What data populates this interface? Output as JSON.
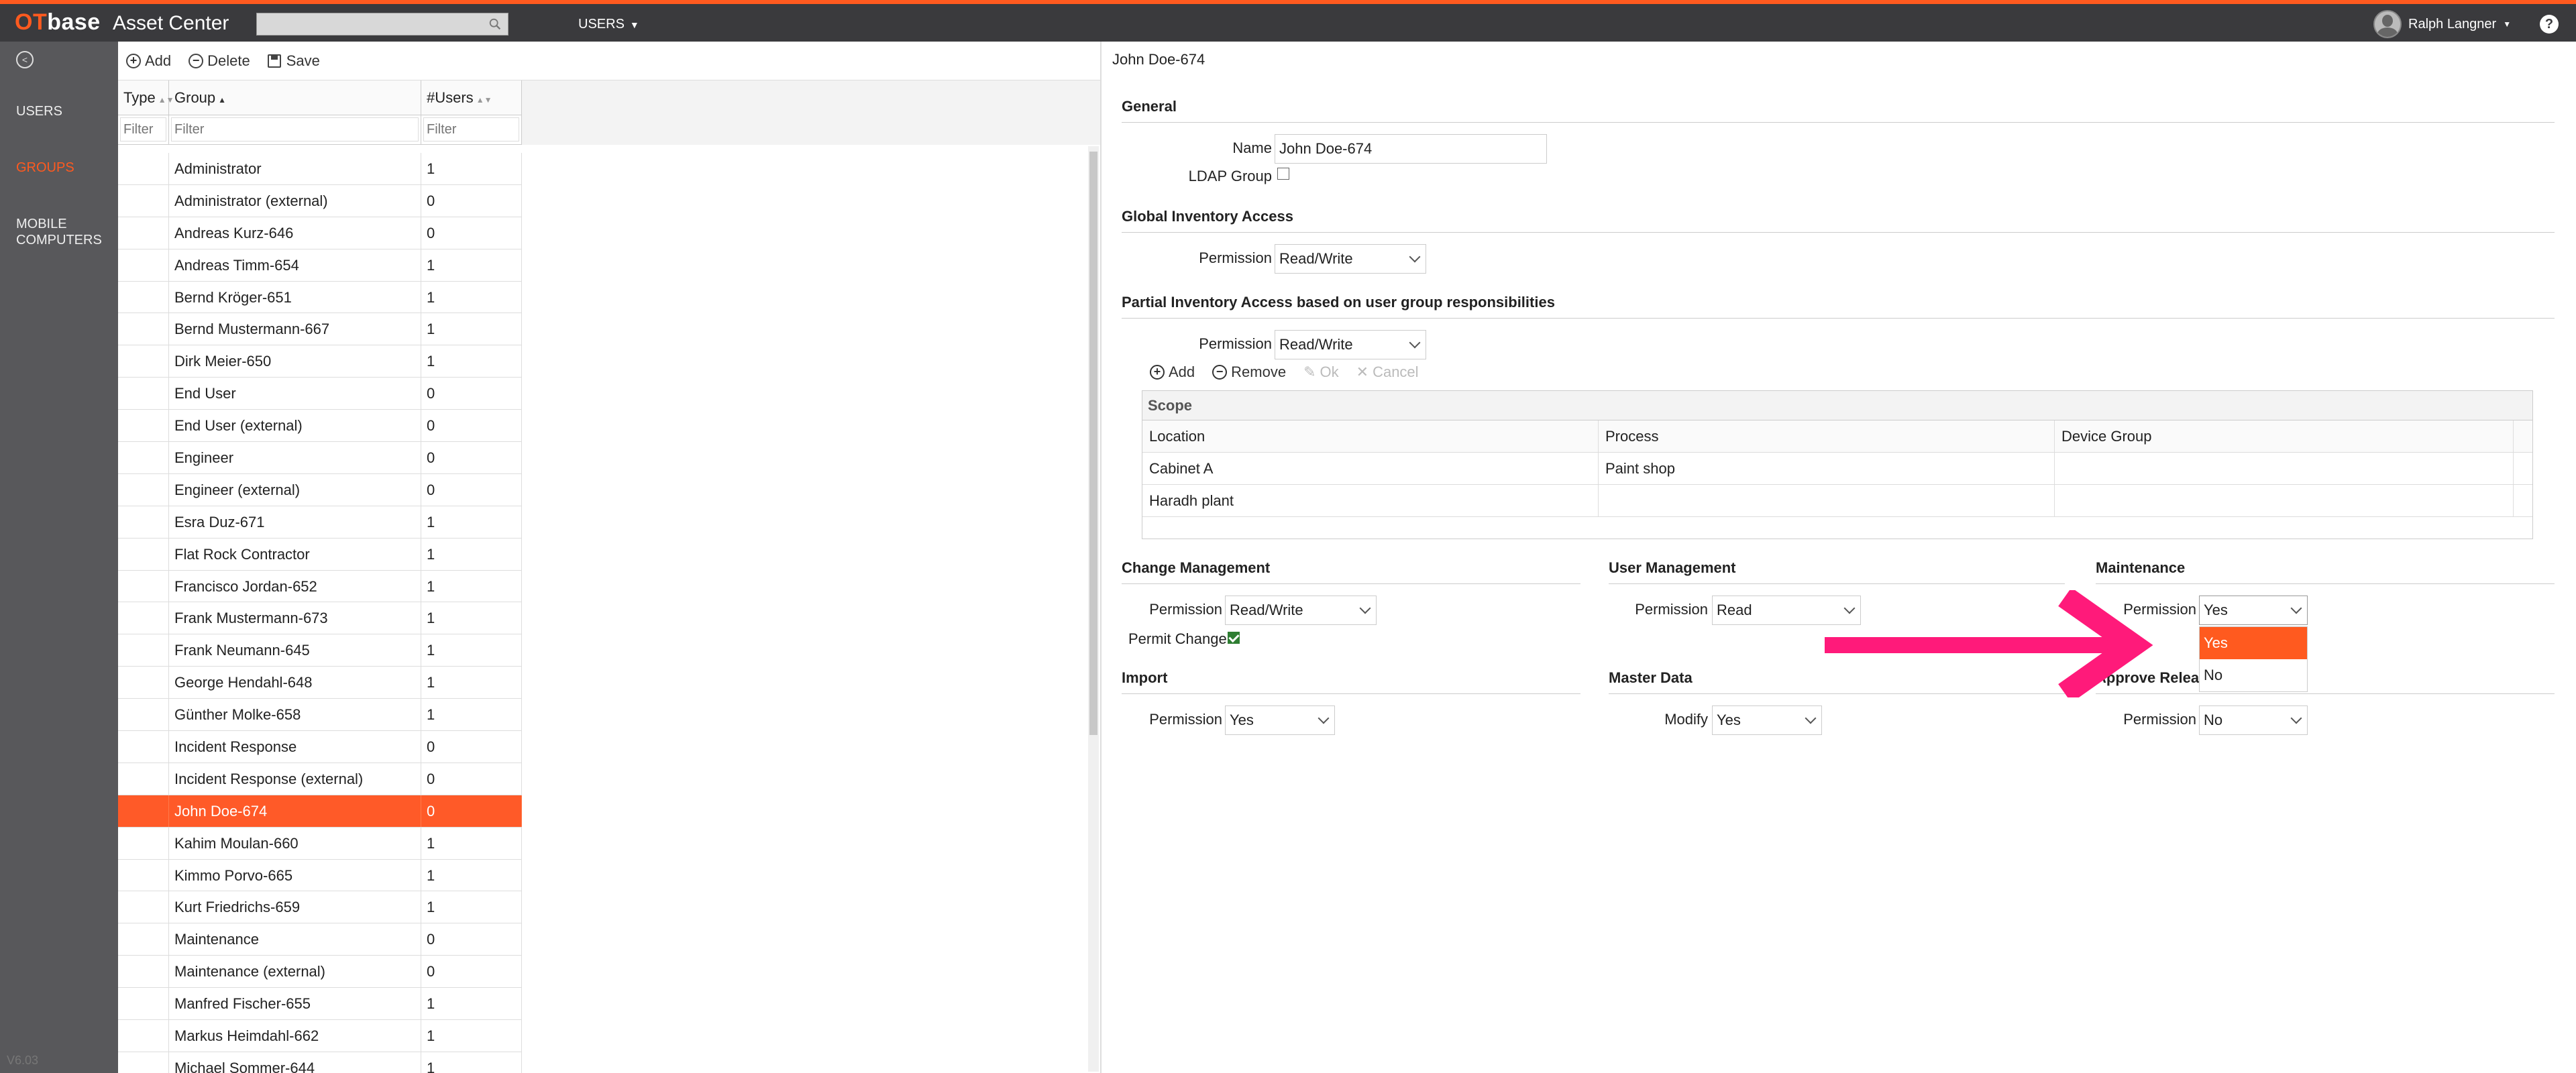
{
  "header": {
    "logo_ot": "OT",
    "logo_base": "base",
    "app_title": "Asset Center",
    "search_placeholder": "",
    "nav_label": "USERS",
    "user_name": "Ralph Langner",
    "help": "?"
  },
  "leftnav": {
    "items": [
      {
        "label": "USERS"
      },
      {
        "label": "GROUPS"
      },
      {
        "label": "MOBILE COMPUTERS"
      }
    ],
    "version": "V6.03"
  },
  "toolbar": {
    "add": "Add",
    "delete": "Delete",
    "save": "Save"
  },
  "grid": {
    "columns": [
      "Type",
      "Group",
      "#Users"
    ],
    "filter_placeholder": "Filter",
    "rows": [
      {
        "group": "Administrator",
        "users": "1"
      },
      {
        "group": "Administrator (external)",
        "users": "0"
      },
      {
        "group": "Andreas Kurz-646",
        "users": "0"
      },
      {
        "group": "Andreas Timm-654",
        "users": "1"
      },
      {
        "group": "Bernd Kröger-651",
        "users": "1"
      },
      {
        "group": "Bernd Mustermann-667",
        "users": "1"
      },
      {
        "group": "Dirk Meier-650",
        "users": "1"
      },
      {
        "group": "End User",
        "users": "0"
      },
      {
        "group": "End User (external)",
        "users": "0"
      },
      {
        "group": "Engineer",
        "users": "0"
      },
      {
        "group": "Engineer (external)",
        "users": "0"
      },
      {
        "group": "Esra Duz-671",
        "users": "1"
      },
      {
        "group": "Flat Rock Contractor",
        "users": "1"
      },
      {
        "group": "Francisco Jordan-652",
        "users": "1"
      },
      {
        "group": "Frank Mustermann-673",
        "users": "1"
      },
      {
        "group": "Frank Neumann-645",
        "users": "1"
      },
      {
        "group": "George Hendahl-648",
        "users": "1"
      },
      {
        "group": "Günther Molke-658",
        "users": "1"
      },
      {
        "group": "Incident Response",
        "users": "0"
      },
      {
        "group": "Incident Response (external)",
        "users": "0"
      },
      {
        "group": "John Doe-674",
        "users": "0"
      },
      {
        "group": "Kahim Moulan-660",
        "users": "1"
      },
      {
        "group": "Kimmo Porvo-665",
        "users": "1"
      },
      {
        "group": "Kurt Friedrichs-659",
        "users": "1"
      },
      {
        "group": "Maintenance",
        "users": "0"
      },
      {
        "group": "Maintenance (external)",
        "users": "0"
      },
      {
        "group": "Manfred Fischer-655",
        "users": "1"
      },
      {
        "group": "Markus Heimdahl-662",
        "users": "1"
      },
      {
        "group": "Michael Sommer-644",
        "users": "1"
      }
    ],
    "selected_index": 20
  },
  "detail": {
    "title": "John Doe-674",
    "general": {
      "heading": "General",
      "name_label": "Name",
      "name_value": "John Doe-674",
      "ldap_label": "LDAP Group"
    },
    "global": {
      "heading": "Global Inventory Access",
      "permission_label": "Permission",
      "permission_value": "Read/Write"
    },
    "partial": {
      "heading": "Partial Inventory Access based on user group responsibilities",
      "permission_label": "Permission",
      "permission_value": "Read/Write",
      "toolbar": {
        "add": "Add",
        "remove": "Remove",
        "ok": "Ok",
        "cancel": "Cancel"
      },
      "scope_title": "Scope",
      "columns": [
        "Location",
        "Process",
        "Device Group"
      ],
      "rows": [
        {
          "location": "Cabinet A",
          "process": "Paint shop",
          "device": ""
        },
        {
          "location": "Haradh plant",
          "process": "",
          "device": ""
        }
      ]
    },
    "change_mgmt": {
      "heading": "Change Management",
      "permission_label": "Permission",
      "permission_value": "Read/Write",
      "permit_change_label": "Permit Change"
    },
    "user_mgmt": {
      "heading": "User Management",
      "permission_label": "Permission",
      "permission_value": "Read"
    },
    "maintenance": {
      "heading": "Maintenance",
      "permission_label": "Permission",
      "permission_value": "Yes",
      "options": [
        "Yes",
        "No"
      ]
    },
    "import": {
      "heading": "Import",
      "permission_label": "Permission",
      "permission_value": "Yes"
    },
    "master_data": {
      "heading": "Master Data",
      "modify_label": "Modify",
      "modify_value": "Yes"
    },
    "approve_release": {
      "heading": "Approve Releas",
      "permission_label": "Permission",
      "permission_value": "No"
    }
  },
  "colors": {
    "accent": "#ff5a1f",
    "header_bg": "#3a3a3d",
    "sidebar_bg": "#58585b",
    "arrow": "#ff1a7a"
  }
}
